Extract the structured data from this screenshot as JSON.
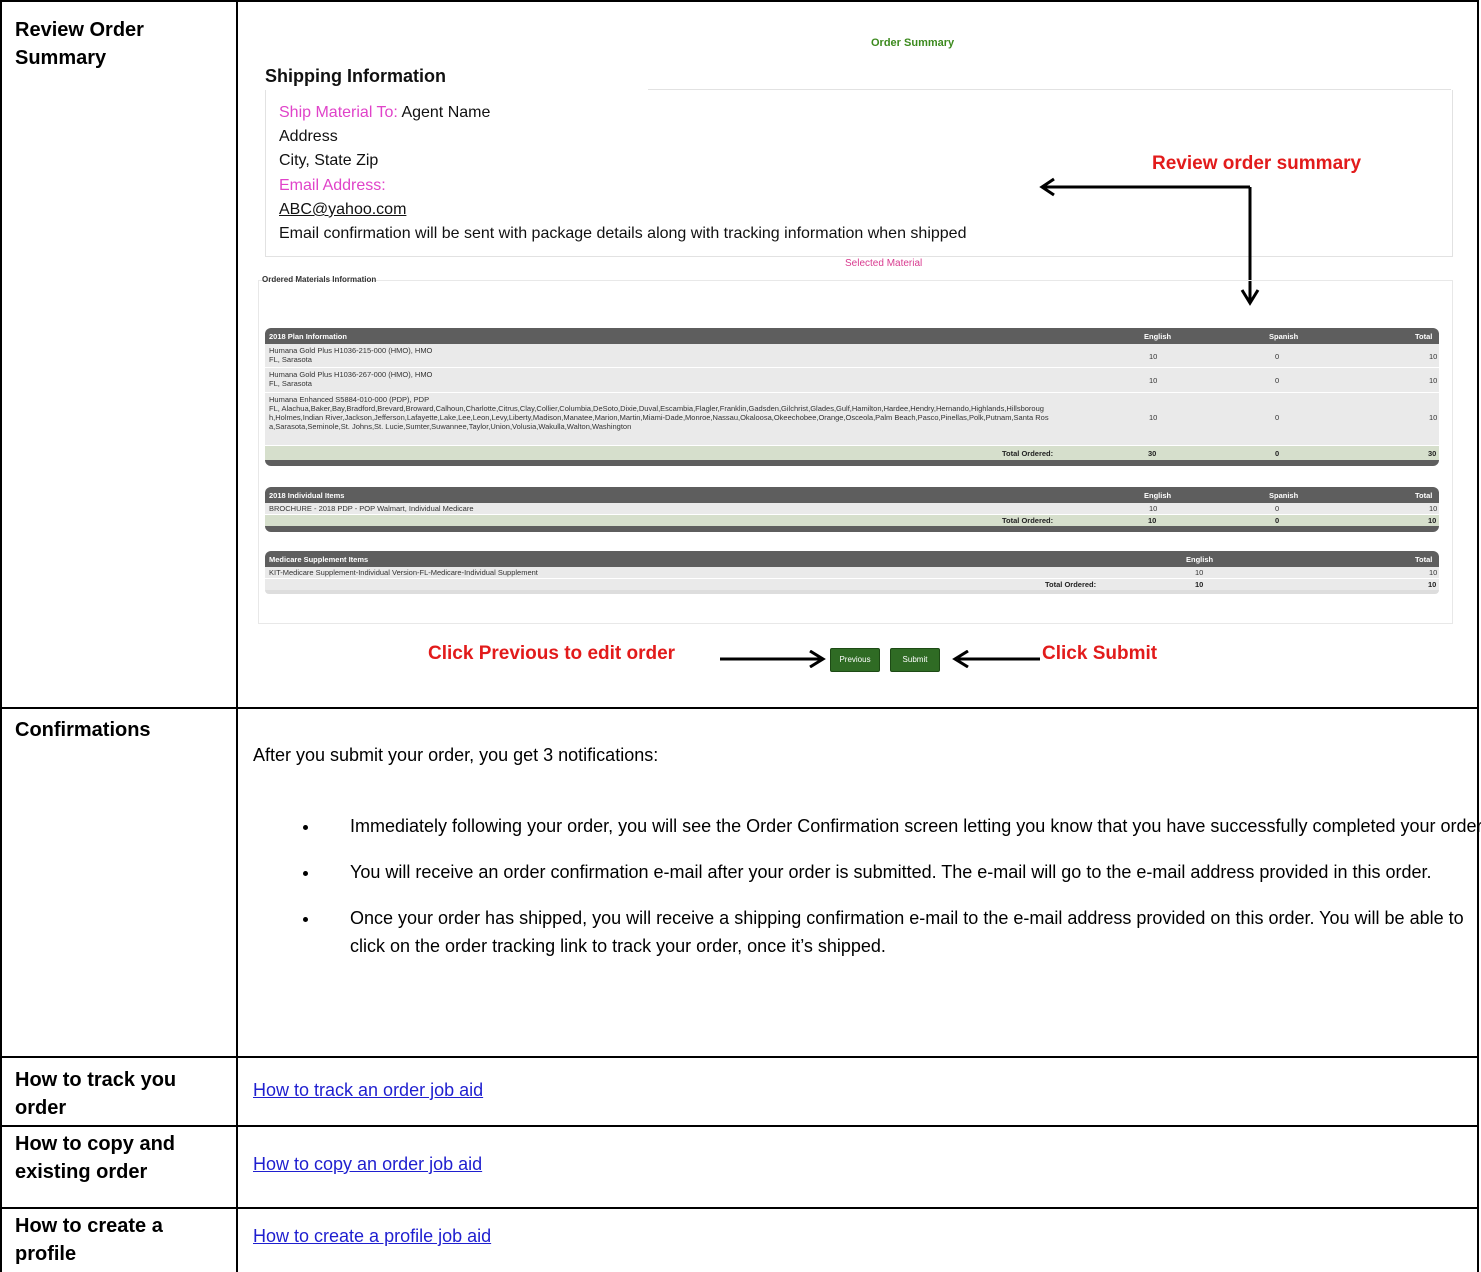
{
  "rows": {
    "review": {
      "label": "Review Order Summary"
    },
    "confirmations": {
      "label": "Confirmations"
    },
    "track": {
      "label": "How to track you order",
      "link": "How to track an order job aid"
    },
    "copy": {
      "label": "How to copy and existing order",
      "link": "How to copy an order job aid"
    },
    "profile": {
      "label": "How to create a profile",
      "link": "How to create a profile job aid"
    }
  },
  "screenshot": {
    "order_summary_title": "Order Summary",
    "shipping_title": "Shipping Information",
    "ship_to_label": "Ship Material To:",
    "ship_to_value": "Agent Name",
    "address": "Address",
    "city_state_zip": "City, State Zip",
    "email_label": "Email Address:",
    "email_value": "ABC@yahoo.com",
    "email_note": "Email confirmation will be sent with package details along with tracking information when shipped",
    "review_callout": "Review order summary",
    "selected_material": "Selected Material",
    "ordered_materials_label": "Ordered Materials Information",
    "plan_table": {
      "header": [
        "2018 Plan Information",
        "English",
        "Spanish",
        "Total"
      ],
      "rows": [
        {
          "name": "Humana Gold Plus H1036-215-000 (HMO), HMO",
          "sub": "FL, Sarasota",
          "english": "10",
          "spanish": "0",
          "total": "10"
        },
        {
          "name": "Humana Gold Plus H1036-267-000 (HMO), HMO",
          "sub": "FL, Sarasota",
          "english": "10",
          "spanish": "0",
          "total": "10"
        },
        {
          "name": "Humana Enhanced S5884-010-000 (PDP), PDP",
          "sub": "FL, Alachua,Baker,Bay,Bradford,Brevard,Broward,Calhoun,Charlotte,Citrus,Clay,Collier,Columbia,DeSoto,Dixie,Duval,Escambia,Flagler,Franklin,Gadsden,Gilchrist,Glades,Gulf,Hamilton,Hardee,Hendry,Hernando,Highlands,Hillsboroug h,Holmes,Indian River,Jackson,Jefferson,Lafayette,Lake,Lee,Leon,Levy,Liberty,Madison,Manatee,Marion,Martin,Miami-Dade,Monroe,Nassau,Okaloosa,Okeechobee,Orange,Osceola,Palm Beach,Pasco,Pinellas,Polk,Putnam,Santa Ros a,Sarasota,Seminole,St. Johns,St. Lucie,Sumter,Suwannee,Taylor,Union,Volusia,Wakulla,Walton,Washington",
          "english": "10",
          "spanish": "0",
          "total": "10"
        }
      ],
      "total_label": "Total Ordered:",
      "totals": {
        "english": "30",
        "spanish": "0",
        "total": "30"
      }
    },
    "individual_table": {
      "header": [
        "2018 Individual Items",
        "English",
        "Spanish",
        "Total"
      ],
      "rows": [
        {
          "name": "BROCHURE - 2018 PDP - POP Walmart, Individual Medicare",
          "english": "10",
          "spanish": "0",
          "total": "10"
        }
      ],
      "total_label": "Total Ordered:",
      "totals": {
        "english": "10",
        "spanish": "0",
        "total": "10"
      }
    },
    "supplement_table": {
      "header": [
        "Medicare Supplement Items",
        "English",
        "Total"
      ],
      "rows": [
        {
          "name": "KIT-Medicare Supplement-Individual Version-FL-Medicare-Individual Supplement",
          "english": "10",
          "total": "10"
        }
      ],
      "total_label": "Total Ordered:",
      "totals": {
        "english": "10",
        "total": "10"
      }
    },
    "previous_button": "Previous",
    "submit_button": "Submit",
    "previous_callout": "Click Previous to edit order",
    "submit_callout": "Click Submit"
  },
  "confirmations": {
    "intro": "After you submit your order, you get 3 notifications:",
    "bullets": [
      "Immediately following your order, you will see the Order Confirmation screen letting you know that you have successfully completed your order",
      "You will receive an order confirmation e-mail after your order is submitted.  The e-mail will go to the e-mail address provided in this order.",
      "Once your order has shipped, you will receive a shipping confirmation e-mail to the e-mail address provided on this order.  You will be able to click on the order tracking link to track your order, once it’s shipped."
    ]
  }
}
